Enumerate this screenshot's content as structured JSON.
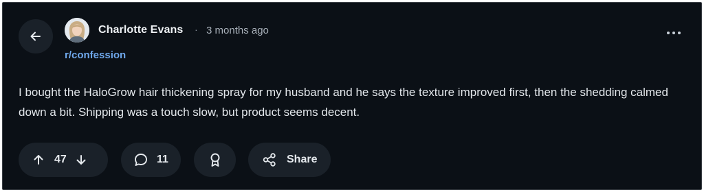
{
  "post": {
    "author": "Charlotte Evans",
    "separator": "·",
    "time_ago": "3 months ago",
    "subreddit": "r/confession",
    "body": "I bought the HaloGrow hair thickening spray for my husband and he says the texture improved first, then the shedding calmed down a bit. Shipping was a touch slow, but product seems decent."
  },
  "actions": {
    "vote_count": "47",
    "comment_count": "11",
    "share_label": "Share"
  },
  "icons": {
    "back": "arrow-left-icon",
    "more": "more-horizontal-icon",
    "upvote": "arrow-up-icon",
    "downvote": "arrow-down-icon",
    "comment": "comment-bubble-icon",
    "award": "award-ribbon-icon",
    "share": "share-nodes-icon"
  },
  "colors": {
    "background": "#0b1016",
    "pill": "#1a2129",
    "subreddit_link": "#6fa8ec",
    "text": "#e3e7eb"
  }
}
